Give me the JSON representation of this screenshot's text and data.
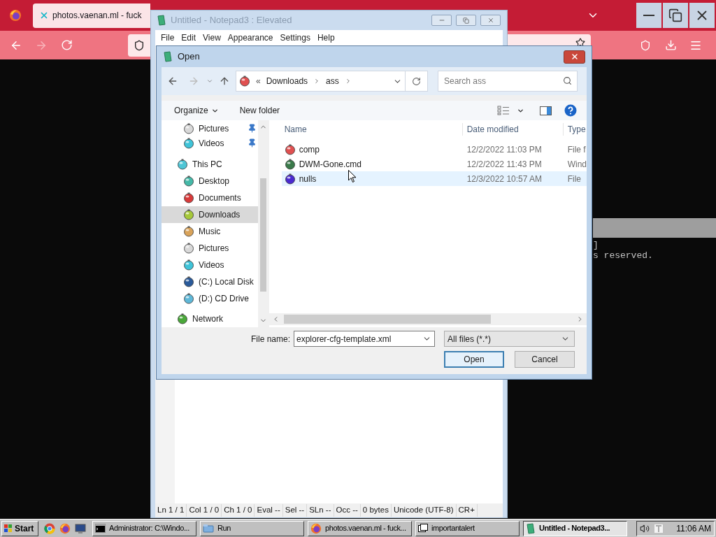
{
  "browser": {
    "tab_title": "photos.vaenan.ml - fuck"
  },
  "console": {
    "lines": [
      "]",
      "s reserved."
    ]
  },
  "notepad": {
    "title": "Untitled - Notepad3 : Elevated",
    "menu": [
      "File",
      "Edit",
      "View",
      "Appearance",
      "Settings",
      "Help"
    ],
    "status": [
      "Ln 1 / 1",
      "Col 1 / 0",
      "Ch 1 / 0",
      "Eval --",
      "Sel --",
      "SLn --",
      "Occ --",
      "0 bytes",
      "Unicode (UTF-8)",
      "CR+"
    ]
  },
  "dialog": {
    "title": "Open",
    "breadcrumb_prefix": "«",
    "path": [
      "Downloads",
      "ass"
    ],
    "search": {
      "placeholder": "Search ass"
    },
    "commands": [
      "Organize",
      "New folder"
    ],
    "quick_access_items": [
      {
        "label": "Pictures",
        "pinned": true,
        "selected": false,
        "color": "#d8d8d8"
      },
      {
        "label": "Videos",
        "pinned": true,
        "selected": false,
        "color": "#3fc3d8"
      }
    ],
    "sections": [
      {
        "label": "This PC",
        "selected": false,
        "color": "#4fc6d6",
        "children": [
          {
            "label": "Desktop",
            "selected": false,
            "color": "#45b9a8"
          },
          {
            "label": "Documents",
            "selected": false,
            "color": "#d83a3a"
          },
          {
            "label": "Downloads",
            "selected": true,
            "color": "#a6c83a"
          },
          {
            "label": "Music",
            "selected": false,
            "color": "#d9a35a"
          },
          {
            "label": "Pictures",
            "selected": false,
            "color": "#d8d8d8"
          },
          {
            "label": "Videos",
            "selected": false,
            "color": "#3fc3d8"
          },
          {
            "label": "(C:) Local Disk",
            "selected": false,
            "color": "#2a5a9a"
          },
          {
            "label": "(D:) CD Drive",
            "selected": false,
            "color": "#5fb8d8"
          }
        ]
      },
      {
        "label": "Network",
        "selected": false,
        "color": "#4aa83a"
      }
    ],
    "columns": [
      "Name",
      "Date modified",
      "Type"
    ],
    "rows": [
      {
        "name": "comp",
        "date": "12/2/2022 11:03 PM",
        "type": "File f",
        "selected": false,
        "color": "#e05050"
      },
      {
        "name": "DWM-Gone.cmd",
        "date": "12/2/2022 11:43 PM",
        "type": "Wind",
        "selected": false,
        "color": "#3a7a4a"
      },
      {
        "name": "nulls",
        "date": "12/3/2022 10:57 AM",
        "type": "File",
        "selected": true,
        "color": "#4a2ad0"
      }
    ],
    "file_name_label": "File name:",
    "file_name": "explorer-cfg-template.xml",
    "file_type": "All files (*.*)",
    "buttons": [
      {
        "label": "Open",
        "kind": "primary"
      },
      {
        "label": "Cancel",
        "kind": "normal"
      }
    ]
  },
  "taskbar": {
    "start": "Start",
    "tasks": [
      {
        "label": "Administrator: C:\\Windo...",
        "kind": "console",
        "selected": false
      },
      {
        "label": "Run",
        "kind": "run",
        "selected": false
      },
      {
        "label": "photos.vaenan.ml - fuck...",
        "kind": "firefox",
        "selected": false
      },
      {
        "label": "importantalert",
        "kind": "window",
        "selected": false
      },
      {
        "label": "Untitled - Notepad3...",
        "kind": "notepad",
        "selected": true
      }
    ],
    "clock": "11:06 AM"
  }
}
